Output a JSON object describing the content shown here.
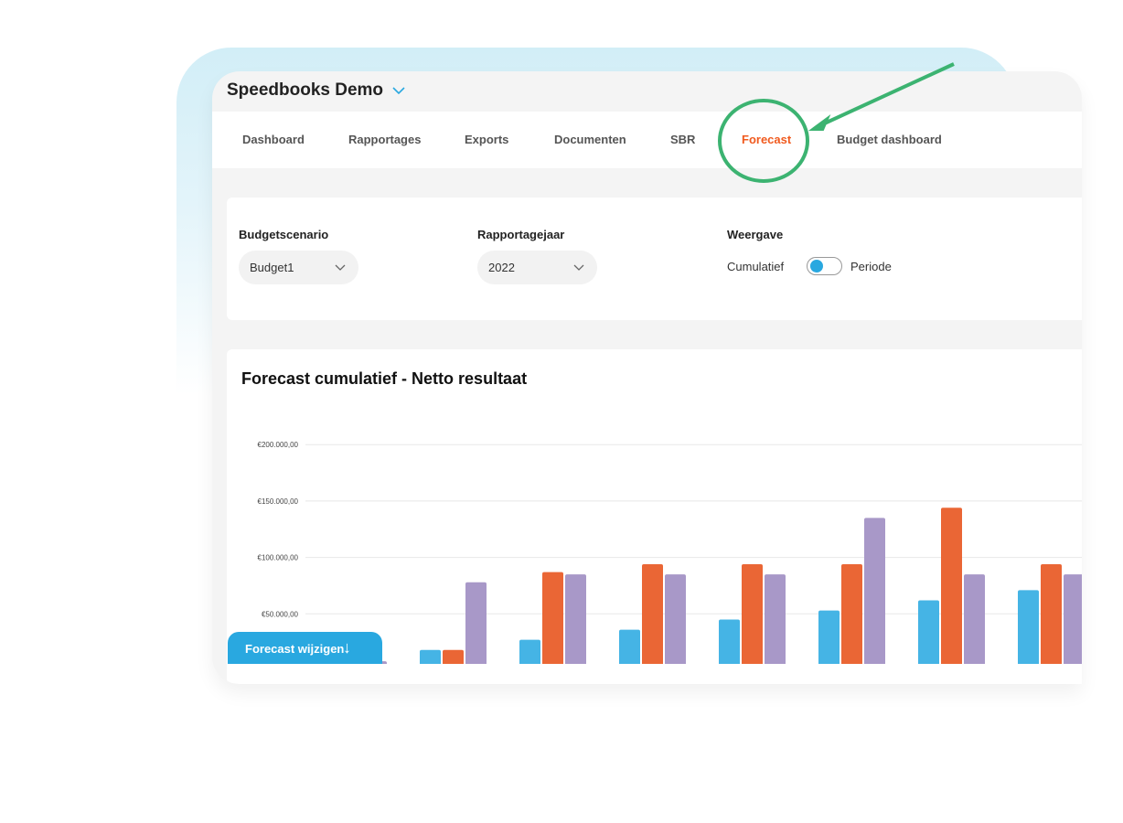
{
  "app": {
    "title": "Speedbooks Demo"
  },
  "nav": {
    "items": [
      {
        "label": "Dashboard"
      },
      {
        "label": "Rapportages"
      },
      {
        "label": "Exports"
      },
      {
        "label": "Documenten"
      },
      {
        "label": "SBR"
      },
      {
        "label": "Forecast",
        "active": true
      },
      {
        "label": "Budget dashboard"
      }
    ]
  },
  "filters": {
    "budgetscenario": {
      "label": "Budgetscenario",
      "value": "Budget1"
    },
    "rapportagejaar": {
      "label": "Rapportagejaar",
      "value": "2022"
    },
    "weergave": {
      "label": "Weergave",
      "left": "Cumulatief",
      "right": "Periode",
      "selected": "Cumulatief"
    }
  },
  "chart_data": {
    "type": "bar",
    "title": "Forecast cumulatief - Netto resultaat",
    "ylim": [
      0,
      200000
    ],
    "yticks": [
      "€50.000,00",
      "€100.000,00",
      "€150.000,00",
      "€200.000,00"
    ],
    "ytick_values": [
      50000,
      100000,
      150000,
      200000
    ],
    "grid": true,
    "series": [
      {
        "color": "#45b4e5",
        "values": [
          9000,
          18000,
          27000,
          36000,
          45000,
          53000,
          62000,
          71000
        ]
      },
      {
        "color": "#ea6635",
        "values": [
          9000,
          18000,
          87000,
          94000,
          94000,
          94000,
          144000,
          94000
        ]
      },
      {
        "color": "#a898c8",
        "values": [
          8000,
          78000,
          85000,
          85000,
          85000,
          135000,
          85000,
          85000
        ]
      }
    ]
  },
  "actions": {
    "forecast_wijzigen": "Forecast wijzigen",
    "arrow": "↓"
  },
  "colors": {
    "accent": "#29a8e0",
    "active_tab": "#f05a1e",
    "annotation": "#3cb371"
  }
}
